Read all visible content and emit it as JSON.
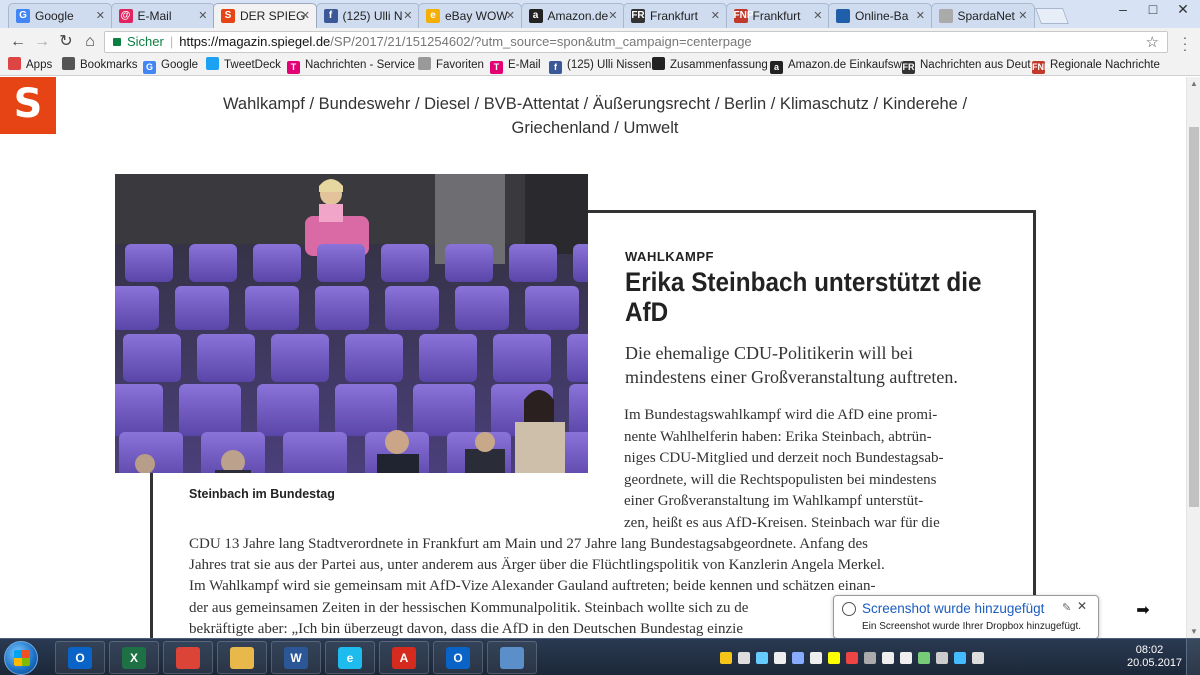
{
  "browser": {
    "tabs": [
      {
        "title": "Google",
        "favicon_color": "#4285f4",
        "glyph": "G",
        "active": false
      },
      {
        "title": "E-Mail",
        "favicon_color": "#e0245e",
        "glyph": "@",
        "active": false
      },
      {
        "title": "DER SPIEG",
        "favicon_color": "#e64415",
        "glyph": "S",
        "active": true
      },
      {
        "title": "(125) Ulli N",
        "favicon_color": "#3b5998",
        "glyph": "f",
        "active": false
      },
      {
        "title": "eBay WOW",
        "favicon_color": "#f5af02",
        "glyph": "e",
        "active": false
      },
      {
        "title": "Amazon.de",
        "favicon_color": "#222222",
        "glyph": "a",
        "active": false
      },
      {
        "title": "Frankfurt",
        "favicon_color": "#333333",
        "glyph": "FR",
        "active": false
      },
      {
        "title": "Frankfurt",
        "favicon_color": "#c0392b",
        "glyph": "FNP",
        "active": false
      },
      {
        "title": "Online-Ba",
        "favicon_color": "#1f5fa8",
        "glyph": "",
        "active": false
      },
      {
        "title": "SpardaNet",
        "favicon_color": "#aaaaaa",
        "glyph": "",
        "active": false
      }
    ],
    "window_controls": [
      "–",
      "□",
      "✕"
    ],
    "address": {
      "secure_label": "Sicher",
      "host": "https://magazin.spiegel.de",
      "path": "/SP/2017/21/151254602/?utm_source=spon&utm_campaign=centerpage"
    },
    "nav_icons": [
      "back-icon",
      "forward-icon",
      "reload-icon",
      "home-icon"
    ],
    "bookmarks": [
      {
        "label": "Apps",
        "icon": "apps-grid-icon",
        "color": "#d44"
      },
      {
        "label": "Bookmarks",
        "icon": "star-icon",
        "color": "#555"
      },
      {
        "label": "Google",
        "icon": "google-icon",
        "color": "#4285f4",
        "glyph": "G"
      },
      {
        "label": "TweetDeck",
        "icon": "tweetdeck-icon",
        "color": "#1da1f2"
      },
      {
        "label": "Nachrichten - Service",
        "icon": "telekom-icon",
        "color": "#e20074",
        "glyph": "T"
      },
      {
        "label": "Favoriten",
        "icon": "page-icon",
        "color": "#999"
      },
      {
        "label": "E-Mail",
        "icon": "telekom-icon",
        "color": "#e20074",
        "glyph": "T"
      },
      {
        "label": "(125) Ulli Nissen",
        "icon": "facebook-icon",
        "color": "#3b5998",
        "glyph": "f"
      },
      {
        "label": "Zusammenfassung",
        "icon": "bank-icon",
        "color": "#222"
      },
      {
        "label": "Amazon.de Einkaufsw",
        "icon": "amazon-icon",
        "color": "#222",
        "glyph": "a"
      },
      {
        "label": "Nachrichten aus Deut",
        "icon": "fr-icon",
        "color": "#333",
        "glyph": "FR"
      },
      {
        "label": "Regionale Nachrichte",
        "icon": "fnp-icon",
        "color": "#c0392b",
        "glyph": "FNP"
      }
    ]
  },
  "page": {
    "logo_letter": "S",
    "topics_line1": "Wahlkampf / Bundeswehr / Diesel / BVB-Attentat / Äußerungsrecht / Berlin / Klimaschutz / Kinderehe /",
    "topics_line2": "Griechenland / Umwelt",
    "caption": "Steinbach im Bundestag",
    "rubric": "WAHLKAMPF",
    "headline_l1": "Erika Steinbach unterstützt die",
    "headline_l2": "AfD",
    "teaser_l1": "Die ehemalige CDU-Politikerin will bei",
    "teaser_l2": "mindestens einer Großveranstaltung auftreten.",
    "body_right": [
      "Im Bundestagswahlkampf wird die AfD eine promi-",
      "nente Wahlhelferin haben: Erika Steinbach, abtrün-",
      "niges CDU-Mitglied und derzeit noch Bundestagsab-",
      "geordnete, will die Rechtspopulisten bei mindestens",
      "einer Großveranstaltung im Wahlkampf unterstüt-",
      "zen, heißt es aus AfD-Kreisen. Steinbach war für die"
    ],
    "body_full": [
      "CDU 13 Jahre lang Stadtverordnete in Frankfurt am Main und 27 Jahre lang Bundestagsabgeordnete. Anfang des",
      "Jahres trat sie aus der Partei aus, unter anderem aus Ärger über die Flüchtlingspolitik von Kanzlerin Angela Merkel.",
      "Im Wahlkampf wird sie gemeinsam mit AfD-Vize Alexander Gauland auftreten; beide kennen und schätzen einan-",
      "der aus gemeinsamen Zeiten in der hessischen Kommunalpolitik. Steinbach wollte sich zu de",
      "bekräftigte aber: „Ich bin überzeugt davon, dass die AfD in den Deutschen Bundestag einzie"
    ],
    "next_arrow": "➡"
  },
  "toast": {
    "title": "Screenshot wurde hinzugefügt",
    "text": "Ein Screenshot wurde Ihrer Dropbox hinzugefügt."
  },
  "taskbar": {
    "apps": [
      {
        "name": "outlook",
        "color": "#0a64c8",
        "glyph": "O"
      },
      {
        "name": "excel",
        "color": "#1e7145",
        "glyph": "X"
      },
      {
        "name": "chrome",
        "color": "#db4437",
        "glyph": ""
      },
      {
        "name": "explorer",
        "color": "#e8b84a",
        "glyph": ""
      },
      {
        "name": "word",
        "color": "#2b5797",
        "glyph": "W"
      },
      {
        "name": "ie",
        "color": "#1ebbee",
        "glyph": "e"
      },
      {
        "name": "acrobat",
        "color": "#d42b1e",
        "glyph": "A"
      },
      {
        "name": "outlook2",
        "color": "#0a64c8",
        "glyph": "O"
      },
      {
        "name": "remote",
        "color": "#5a8fc9",
        "glyph": ""
      }
    ],
    "time": "08:02",
    "date": "20.05.2017"
  }
}
